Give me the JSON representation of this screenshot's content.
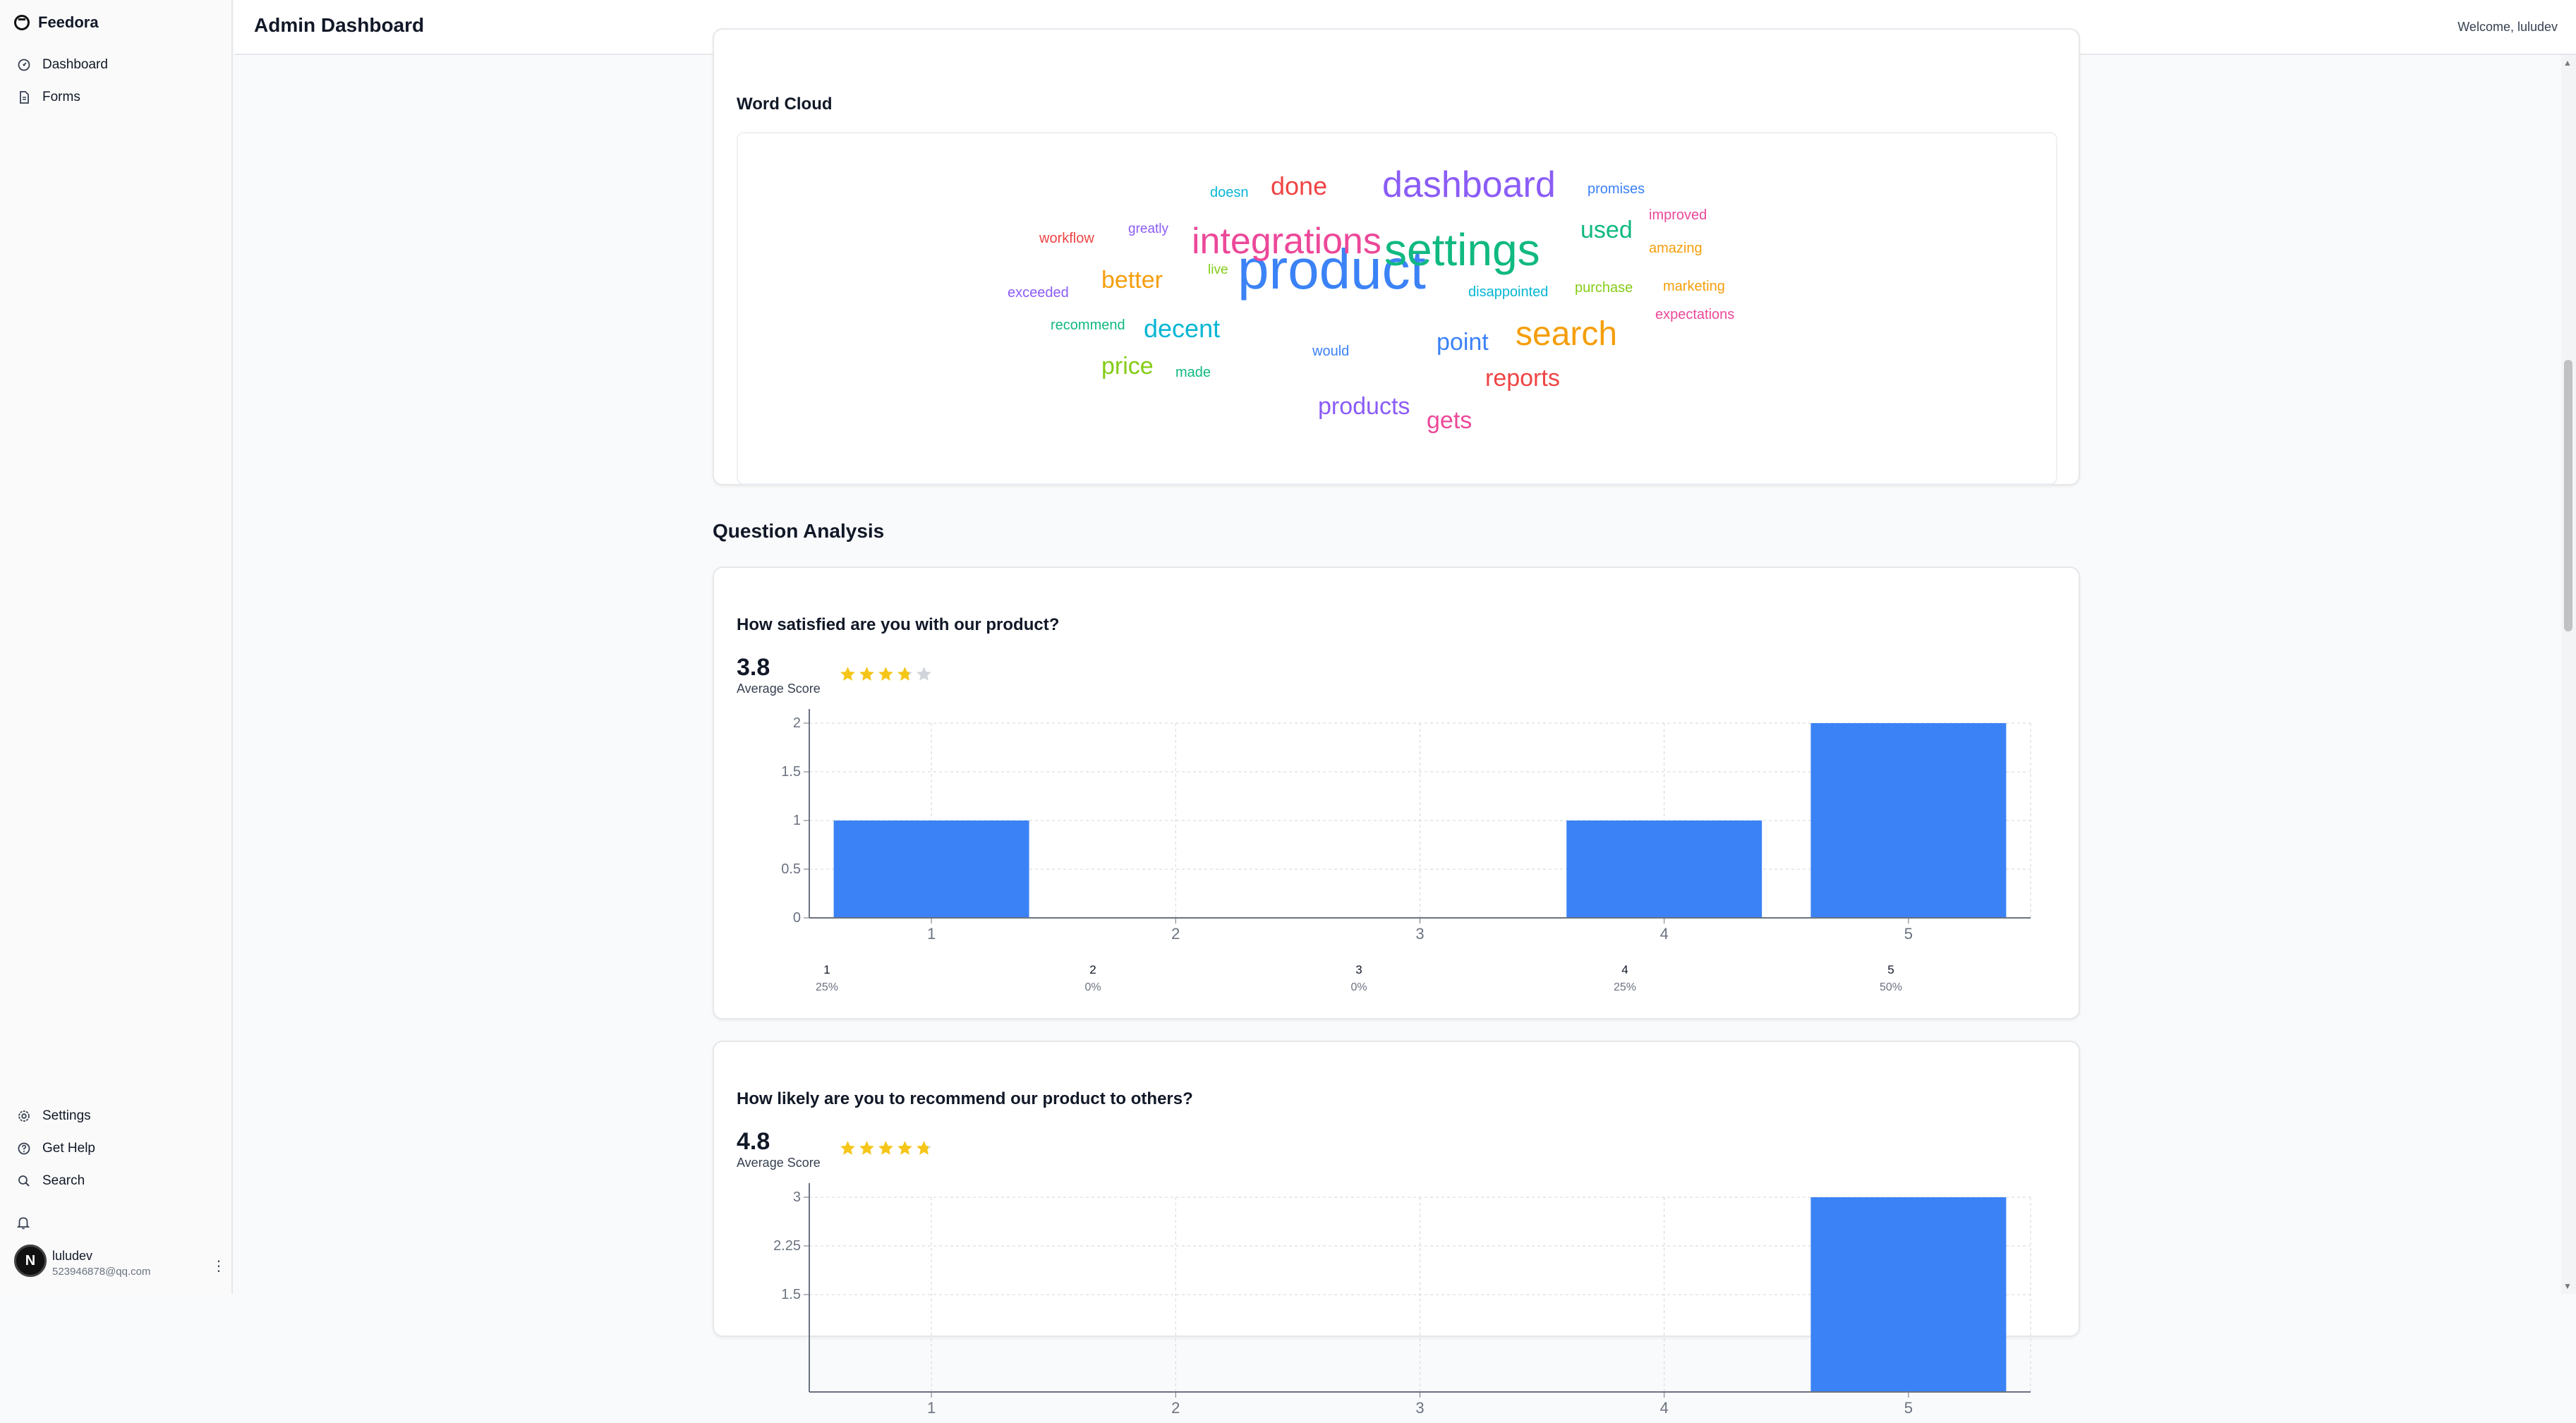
{
  "app": {
    "name": "Feedora"
  },
  "sidebar": {
    "items": [
      {
        "label": "Dashboard",
        "icon": "gauge-icon"
      },
      {
        "label": "Forms",
        "icon": "document-icon"
      }
    ],
    "bottom_items": [
      {
        "label": "Settings",
        "icon": "gear-icon"
      },
      {
        "label": "Get Help",
        "icon": "help-icon"
      },
      {
        "label": "Search",
        "icon": "search-icon"
      }
    ],
    "user": {
      "initial": "N",
      "name": "luludev",
      "email": "523946878@qq.com"
    }
  },
  "header": {
    "title": "Admin Dashboard",
    "welcome": "Welcome, luludev"
  },
  "word_cloud": {
    "title": "Word Cloud",
    "words": [
      {
        "text": "product",
        "color": "#3b82f6"
      },
      {
        "text": "settings",
        "color": "#10b981"
      },
      {
        "text": "integrations",
        "color": "#ec4899"
      },
      {
        "text": "dashboard",
        "color": "#8b5cf6"
      },
      {
        "text": "search",
        "color": "#f59e0b"
      },
      {
        "text": "done",
        "color": "#ef4444"
      },
      {
        "text": "decent",
        "color": "#06b6d4"
      },
      {
        "text": "better",
        "color": "#f59e0b"
      },
      {
        "text": "used",
        "color": "#10b981"
      },
      {
        "text": "point",
        "color": "#3b82f6"
      },
      {
        "text": "price",
        "color": "#84cc16"
      },
      {
        "text": "reports",
        "color": "#ef4444"
      },
      {
        "text": "products",
        "color": "#8b5cf6"
      },
      {
        "text": "gets",
        "color": "#ec4899"
      },
      {
        "text": "doesn",
        "color": "#06b6d4"
      },
      {
        "text": "promises",
        "color": "#3b82f6"
      },
      {
        "text": "improved",
        "color": "#ec4899"
      },
      {
        "text": "greatly",
        "color": "#8b5cf6"
      },
      {
        "text": "workflow",
        "color": "#ef4444"
      },
      {
        "text": "amazing",
        "color": "#f59e0b"
      },
      {
        "text": "live",
        "color": "#84cc16"
      },
      {
        "text": "exceeded",
        "color": "#8b5cf6"
      },
      {
        "text": "disappointed",
        "color": "#06b6d4"
      },
      {
        "text": "purchase",
        "color": "#84cc16"
      },
      {
        "text": "marketing",
        "color": "#f59e0b"
      },
      {
        "text": "recommend",
        "color": "#10b981"
      },
      {
        "text": "expectations",
        "color": "#ec4899"
      },
      {
        "text": "would",
        "color": "#3b82f6"
      },
      {
        "text": "made",
        "color": "#10b981"
      }
    ]
  },
  "analysis": {
    "title": "Question Analysis",
    "questions": [
      {
        "question": "How satisfied are you with our product?",
        "average": "3.8",
        "average_label": "Average Score",
        "rating": 3.8,
        "distribution": [
          {
            "label": "1",
            "pct": "25%"
          },
          {
            "label": "2",
            "pct": "0%"
          },
          {
            "label": "3",
            "pct": "0%"
          },
          {
            "label": "4",
            "pct": "25%"
          },
          {
            "label": "5",
            "pct": "50%"
          }
        ]
      },
      {
        "question": "How likely are you to recommend our product to others?",
        "average": "4.8",
        "average_label": "Average Score",
        "rating": 4.8
      }
    ]
  },
  "chart_data": [
    {
      "type": "bar",
      "categories": [
        "1",
        "2",
        "3",
        "4",
        "5"
      ],
      "values": [
        1,
        0,
        0,
        1,
        2
      ],
      "yticks": [
        "0",
        "0.5",
        "1",
        "1.5",
        "2"
      ],
      "ylim": [
        0,
        2
      ],
      "grid": true,
      "color": "#3b82f6"
    },
    {
      "type": "bar",
      "categories": [
        "1",
        "2",
        "3",
        "4",
        "5"
      ],
      "values": [
        0,
        0,
        0,
        0,
        3
      ],
      "yticks": [
        "1.5",
        "2.25",
        "3"
      ],
      "ylim": [
        0,
        3
      ],
      "grid": true,
      "color": "#3b82f6"
    }
  ]
}
